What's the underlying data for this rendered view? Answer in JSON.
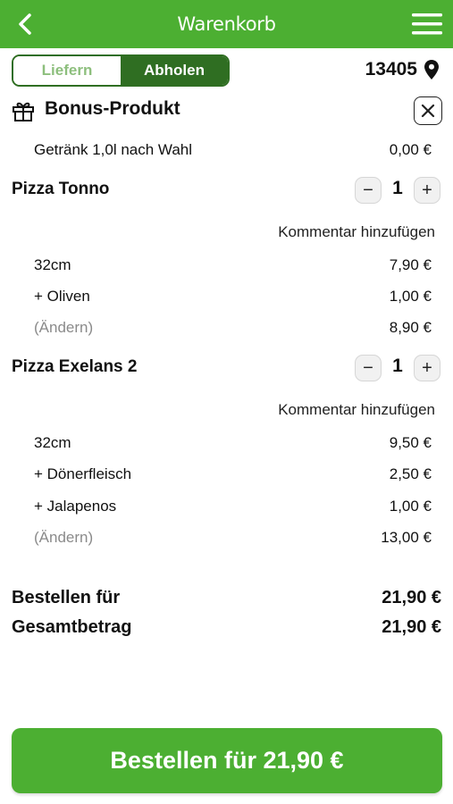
{
  "header": {
    "title": "Warenkorb",
    "back_icon": "chevron-left-icon",
    "menu_icon": "hamburger-menu-icon"
  },
  "mode_toggle": {
    "options": [
      "Liefern",
      "Abholen"
    ],
    "selected": "Abholen"
  },
  "location": {
    "postcode": "13405",
    "icon": "map-pin-icon"
  },
  "bonus": {
    "label": "Bonus-Produkt",
    "icon": "gift-icon",
    "item": {
      "name": "Getränk 1,0l nach Wahl",
      "price": "0,00 €"
    }
  },
  "products": [
    {
      "name": "Pizza Tonno",
      "quantity": "1",
      "comment_label": "Kommentar hinzufügen",
      "lines": [
        {
          "label": "32cm",
          "price": "7,90 €"
        },
        {
          "label": "+ Oliven",
          "price": "1,00 €"
        }
      ],
      "change_label": "(Ändern)",
      "subtotal": "8,90 €"
    },
    {
      "name": "Pizza Exelans 2",
      "quantity": "1",
      "comment_label": "Kommentar hinzufügen",
      "lines": [
        {
          "label": "32cm",
          "price": "9,50 €"
        },
        {
          "label": "+ Dönerfleisch",
          "price": "2,50 €"
        },
        {
          "label": "+ Jalapenos",
          "price": "1,00 €"
        }
      ],
      "change_label": "(Ändern)",
      "subtotal": "13,00 €"
    }
  ],
  "totals": {
    "order_for_label": "Bestellen für",
    "order_for_value": "21,90 €",
    "grand_total_label": "Gesamtbetrag",
    "grand_total_value": "21,90 €"
  },
  "order_button": {
    "label": "Bestellen für 21,90 €"
  },
  "colors": {
    "brand_green": "#4caf32",
    "dark_green": "#2f6e22",
    "light_green": "#8dbf7d"
  }
}
